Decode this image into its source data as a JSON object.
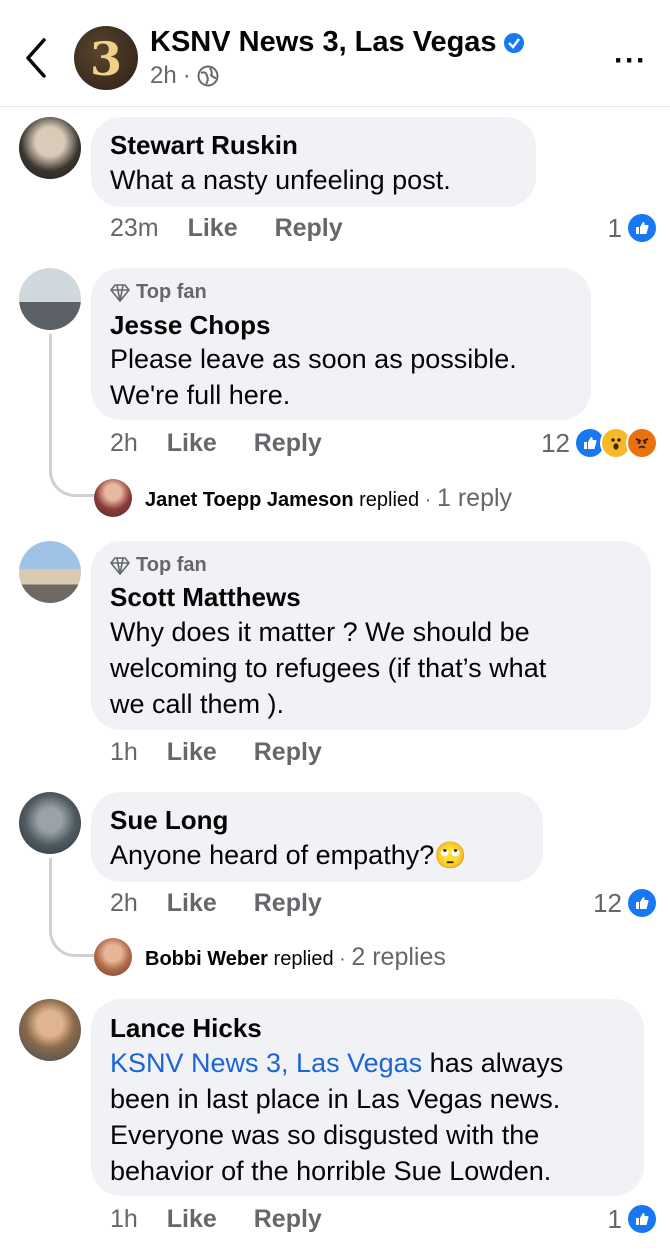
{
  "header": {
    "page_name": "KSNV News 3, Las Vegas",
    "time": "2h",
    "dot": "·",
    "avatar_text": "3",
    "more": "···"
  },
  "comments": [
    {
      "author": "Stewart Ruskin",
      "text": [
        "What a  nasty unfeeling post."
      ],
      "time": "23m",
      "like": "Like",
      "reply": "Reply",
      "reaction_count": "1",
      "reactions": [
        "like-icon"
      ]
    },
    {
      "badge": "Top fan",
      "author": "Jesse Chops",
      "text": [
        "Please leave as soon as possible.",
        "We're full here."
      ],
      "time": "2h",
      "like": "Like",
      "reply": "Reply",
      "reaction_count": "12",
      "reactions": [
        "like-icon",
        "wow-icon",
        "angry-icon"
      ],
      "replies_summary": {
        "name": "Janet Toepp Jameson",
        "replied": "replied",
        "dot": "·",
        "count": "1 reply"
      }
    },
    {
      "badge": "Top fan",
      "author": "Scott Matthews",
      "text": [
        "Why does it matter ? We should be",
        "welcoming to refugees (if that’s what",
        "we call them )."
      ],
      "time": "1h",
      "like": "Like",
      "reply": "Reply"
    },
    {
      "author": "Sue Long",
      "text": [
        "Anyone heard of empathy?"
      ],
      "emoji": "🙄",
      "time": "2h",
      "like": "Like",
      "reply": "Reply",
      "reaction_count": "12",
      "reactions": [
        "like-icon"
      ],
      "replies_summary": {
        "name": "Bobbi Weber",
        "replied": "replied",
        "dot": "·",
        "count": "2 replies"
      }
    },
    {
      "author": "Lance Hicks",
      "mention": "KSNV News 3, Las Vegas",
      "text": [
        " has always",
        "been in last place in Las Vegas news.",
        "Everyone was so disgusted with the",
        "behavior of the horrible Sue Lowden."
      ],
      "time": "1h",
      "like": "Like",
      "reply": "Reply",
      "reaction_count": "1",
      "reactions": [
        "like-icon"
      ]
    }
  ],
  "colors": {
    "like": "#1877f2",
    "link": "#1b64d8",
    "bubble": "#f0f2f5",
    "muted": "#65676b"
  }
}
